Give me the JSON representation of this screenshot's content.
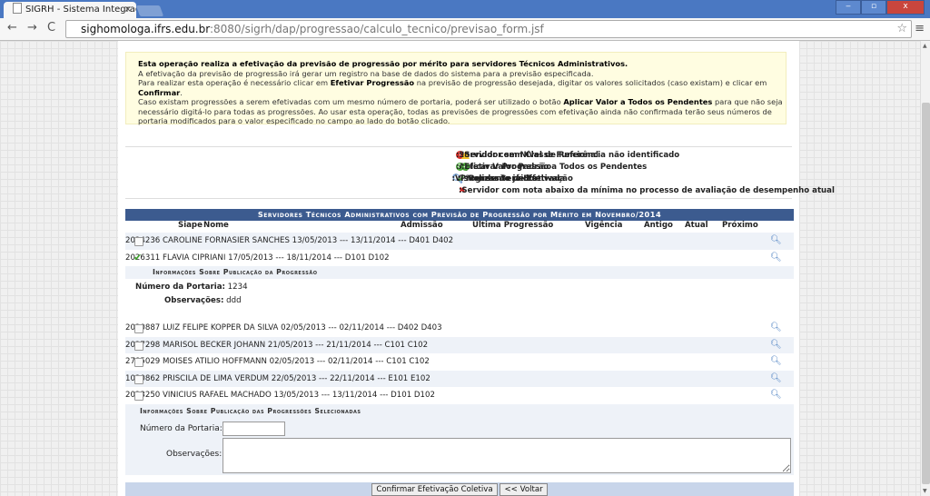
{
  "browser": {
    "tab_title": "SIGRH - Sistema Integrado",
    "tab_close": "×",
    "url_host": "sighomologa.ifrs.edu.br",
    "url_path": ":8080/sigrh/dap/progressao/calculo_tecnico/previsao_form.jsf",
    "back": "←",
    "forward": "→",
    "reload": "C",
    "star": "☆",
    "menu": "≡",
    "minimize": "‒",
    "maximize": "▫",
    "close": "x"
  },
  "info": {
    "line1": "Esta operação realiza a efetivação da previsão de progressão por mérito para servidores Técnicos Administrativos.",
    "line2": "A efetivação da previsão de progressão irá gerar um registro na base de dados do sistema para a previsão especificada.",
    "line3a": "Para realizar esta operação é necessário clicar em ",
    "line3b": "Efetivar Progressão",
    "line3c": " na previsão de progressão desejada, digitar os valores solicitados (caso existam) e clicar em ",
    "line3d": "Confirmar",
    "line3e": ".",
    "line4a": "Caso existam progressões a serem efetivadas com um mesmo número de portaria, poderá ser utilizado o botão ",
    "line4b": "Aplicar Valor a Todos os Pendentes",
    "line4c": " para que não seja necessário digitá-lo para todas as progressões. Ao usar esta operação, todas as previsões de progressões com efetivação ainda não confirmada terão seus números de portaria modificados para o valor especificado no campo ao lado do botão clicado."
  },
  "legend": {
    "ref_not_identified": ":Servidor com Nível de Referência não identificado",
    "no_class": ":Servidor sem Classe Funcional",
    "apply_default": ":Aplicar Valor Padrão a Todos os Pendentes",
    "effect_progression": ":Efetivar Progressão",
    "view_server": ":Visualizar Servidor",
    "already_effected": ":Progressão já Efetivada",
    "pending": ":Pendente de Efetivação",
    "below_min": ":Servidor com nota abaixo da mínima no processo de avaliação de desempenho atual"
  },
  "table": {
    "caption": "Servidores Técnicos Administrativos com Previsão de Progressão por Mérito em Novembro/2014",
    "headers": {
      "siape": "Siape",
      "nome": "Nome",
      "admissao": "Admissão",
      "ultima": "Última Progressão",
      "vigencia": "Vigência",
      "antigo": "Antigo",
      "atual": "Atual",
      "proximo": "Próximo"
    },
    "rows": [
      {
        "siape": "2024236",
        "nome": "CAROLINE FORNASIER SANCHES",
        "admissao": "13/05/2013",
        "ultima": "---",
        "vigencia": "13/11/2014",
        "antigo": "---",
        "atual": "D401",
        "proximo": "D402"
      },
      {
        "siape": "2026311",
        "nome": "FLAVIA CIPRIANI",
        "admissao": "17/05/2013",
        "ultima": "---",
        "vigencia": "18/11/2014",
        "antigo": "---",
        "atual": "D101",
        "proximo": "D102"
      },
      {
        "siape": "2020887",
        "nome": "LUIZ FELIPE KOPPER DA SILVA",
        "admissao": "02/05/2013",
        "ultima": "---",
        "vigencia": "02/11/2014",
        "antigo": "---",
        "atual": "D402",
        "proximo": "D403"
      },
      {
        "siape": "2027298",
        "nome": "MARISOL BECKER JOHANN",
        "admissao": "21/05/2013",
        "ultima": "---",
        "vigencia": "21/11/2014",
        "antigo": "---",
        "atual": "C101",
        "proximo": "C102"
      },
      {
        "siape": "2785029",
        "nome": "MOISES ATILIO HOFFMANN",
        "admissao": "02/05/2013",
        "ultima": "---",
        "vigencia": "02/11/2014",
        "antigo": "---",
        "atual": "C101",
        "proximo": "C102"
      },
      {
        "siape": "1030862",
        "nome": "PRISCILA DE LIMA VERDUM",
        "admissao": "22/05/2013",
        "ultima": "---",
        "vigencia": "22/11/2014",
        "antigo": "---",
        "atual": "E101",
        "proximo": "E102"
      },
      {
        "siape": "2023250",
        "nome": "VINICIUS RAFAEL MACHADO",
        "admissao": "13/05/2013",
        "ultima": "---",
        "vigencia": "13/11/2014",
        "antigo": "---",
        "atual": "D101",
        "proximo": "D102"
      }
    ],
    "publication": {
      "title": "Informações Sobre Publicação da Progressão",
      "portaria_label": "Número da Portaria:",
      "portaria_value": "1234",
      "obs_label": "Observações:",
      "obs_value": "ddd"
    }
  },
  "form": {
    "title": "Informações Sobre Publicação das Progressões Selecionadas",
    "portaria_label": "Número da Portaria:",
    "portaria_value": "",
    "obs_label": "Observações:",
    "obs_value": ""
  },
  "buttons": {
    "confirm": "Confirmar Efetivação Coletiva",
    "back": "<< Voltar"
  }
}
